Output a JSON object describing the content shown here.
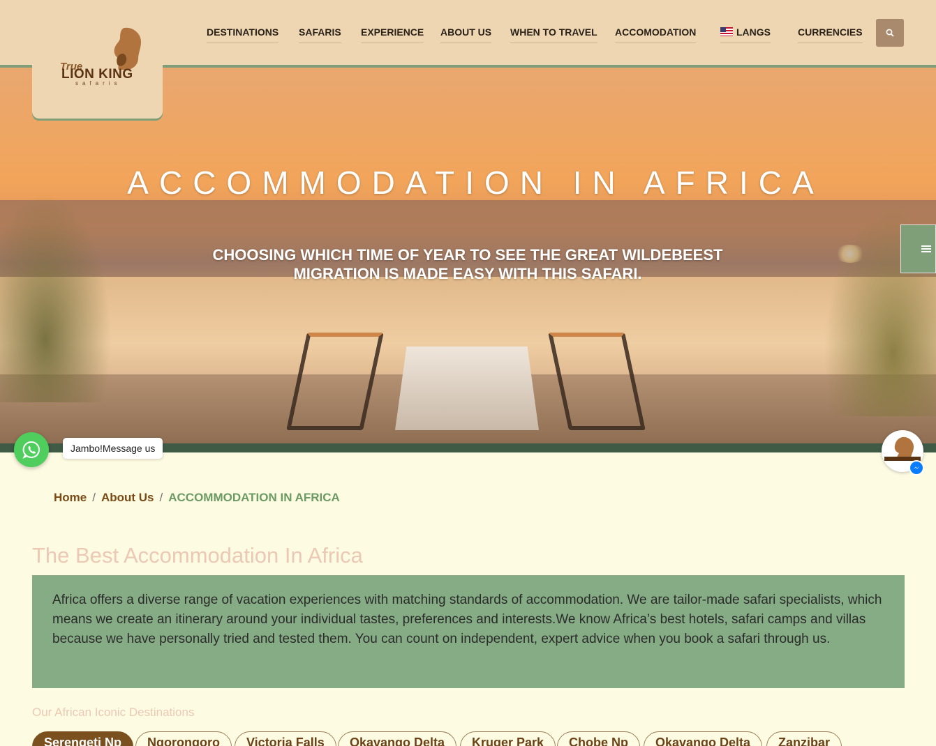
{
  "header": {
    "logo": {
      "top_word": "True",
      "main_word": "LION KING",
      "bottom_word": "safaris"
    },
    "nav": [
      {
        "label": "DESTINATIONS"
      },
      {
        "label": "SAFARIS"
      },
      {
        "label": "EXPERIENCE"
      },
      {
        "label": "ABOUT US"
      },
      {
        "label": "WHEN TO TRAVEL"
      },
      {
        "label": "ACCOMODATION"
      },
      {
        "label": "LANGS",
        "icon": "us-flag-icon"
      },
      {
        "label": "CURRENCIES"
      }
    ],
    "search_icon": "search-icon"
  },
  "hero": {
    "title": "ACCOMMODATION IN AFRICA",
    "subtitle": "CHOOSING WHICH TIME OF YEAR TO SEE THE GREAT WILDEBEEST MIGRATION IS MADE EASY WITH THIS SAFARI.",
    "side_menu_icon": "hamburger-icon"
  },
  "whatsapp": {
    "label": "Jambo!Message us",
    "icon": "whatsapp-icon"
  },
  "messenger": {
    "icon": "messenger-icon"
  },
  "breadcrumb": {
    "home": "Home",
    "parent": "About Us",
    "current": "ACCOMMODATION IN AFRICA"
  },
  "main": {
    "title": "The Best Accommodation In Africa",
    "intro": "Africa offers a diverse range of vacation experiences with matching standards of accommodation. We are tailor-made safari specialists, which means we create an itinerary around your individual tastes, preferences and interests.We know Africa’s best hotels, safari camps and villas because we have personally tried and tested them. You can count on independent, expert advice when you book a safari through us.",
    "destinations_label": "Our African Iconic Destinations",
    "destinations": [
      {
        "label": "Serengeti Np",
        "active": true
      },
      {
        "label": "Ngorongoro"
      },
      {
        "label": "Victoria Falls"
      },
      {
        "label": "Okavango Delta"
      },
      {
        "label": "Kruger Park"
      },
      {
        "label": "Chobe Np"
      },
      {
        "label": "Okavango Delta"
      },
      {
        "label": "Zanzibar"
      }
    ]
  },
  "colors": {
    "header_bg": "#eed6b3",
    "accent_green": "#7f9f79",
    "intro_bg": "#85ac84",
    "brand_brown": "#7a501f",
    "page_bg": "#fefbe3"
  }
}
